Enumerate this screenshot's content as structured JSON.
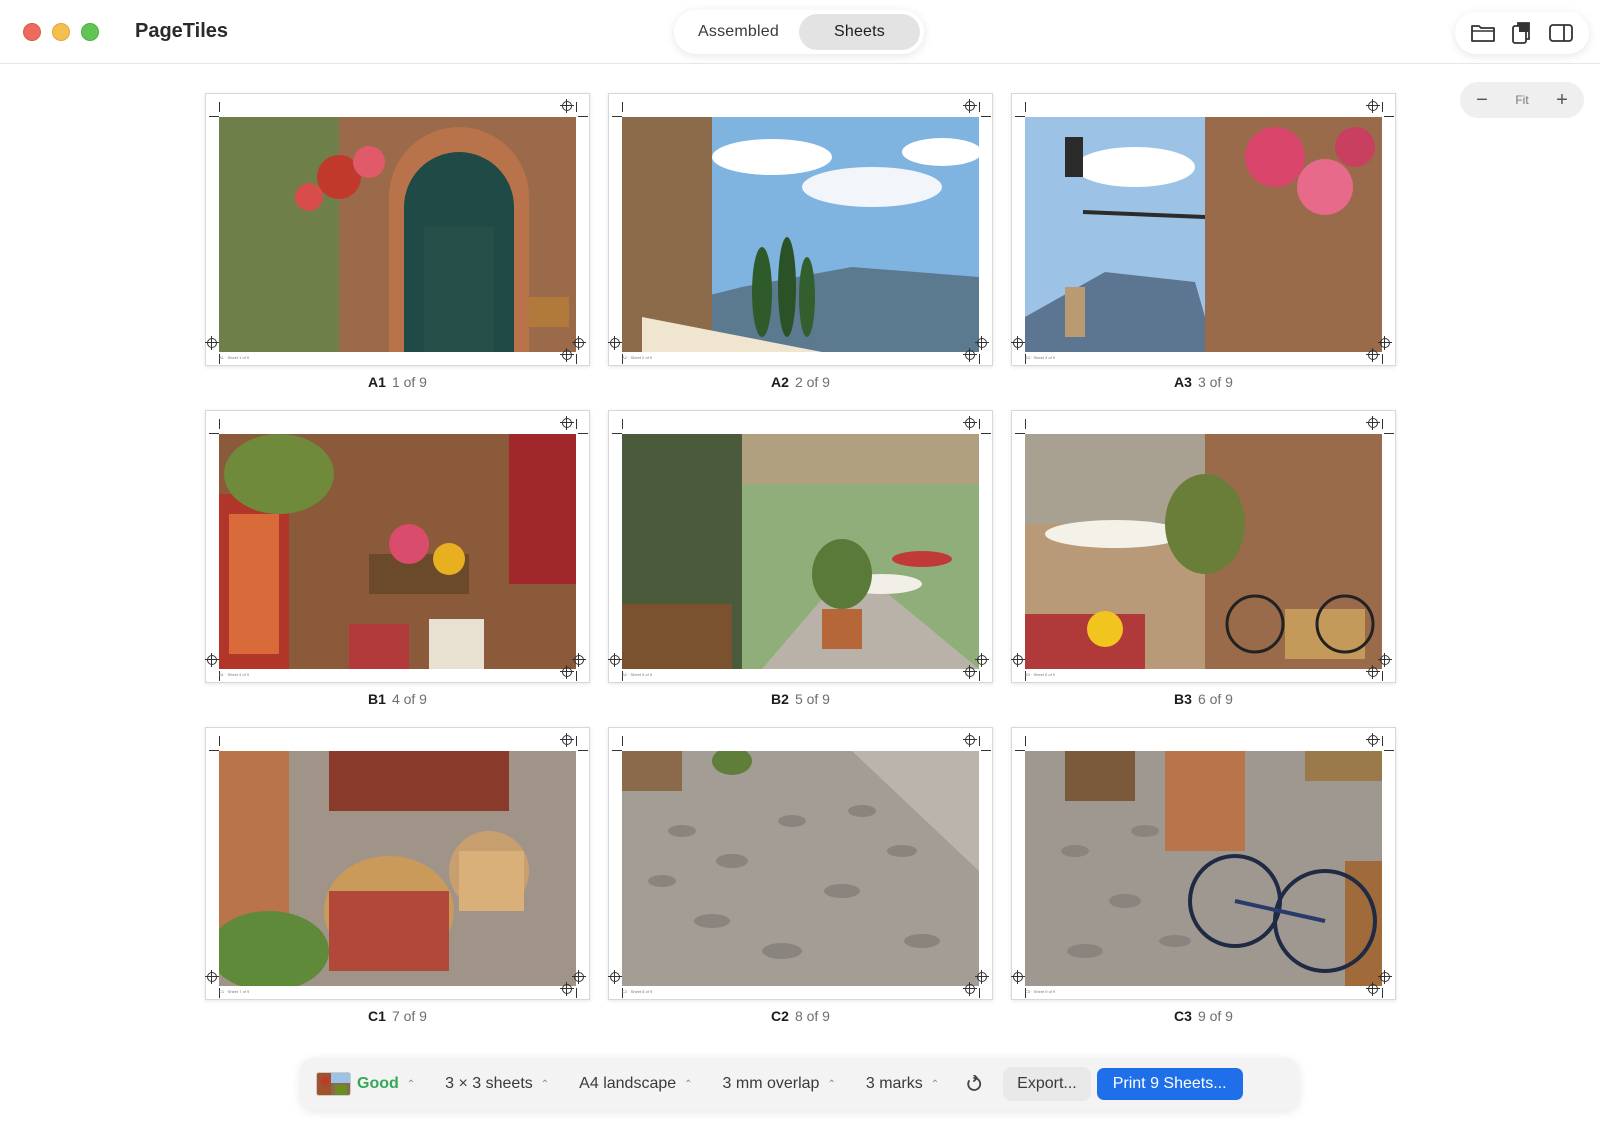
{
  "app": {
    "title": "PageTiles"
  },
  "view_switch": {
    "tabs": [
      {
        "label": "Assembled",
        "active": false
      },
      {
        "label": "Sheets",
        "active": true
      }
    ]
  },
  "toolbar_icons": [
    "folder-icon",
    "copy-pages-icon",
    "sidebar-icon"
  ],
  "zoom": {
    "minus": "−",
    "fit": "Fit",
    "plus": "+"
  },
  "sheets": [
    {
      "id": "A1",
      "position": "1 of 9",
      "footer": "A1 · Sheet 1 of 9"
    },
    {
      "id": "A2",
      "position": "2 of 9",
      "footer": "A2 · Sheet 2 of 9"
    },
    {
      "id": "A3",
      "position": "3 of 9",
      "footer": "A3 · Sheet 3 of 9"
    },
    {
      "id": "B1",
      "position": "4 of 9",
      "footer": "B1 · Sheet 4 of 9"
    },
    {
      "id": "B2",
      "position": "5 of 9",
      "footer": "B2 · Sheet 5 of 9"
    },
    {
      "id": "B3",
      "position": "6 of 9",
      "footer": "B3 · Sheet 6 of 9"
    },
    {
      "id": "C1",
      "position": "7 of 9",
      "footer": "C1 · Sheet 7 of 9"
    },
    {
      "id": "C2",
      "position": "8 of 9",
      "footer": "C2 · Sheet 8 of 9"
    },
    {
      "id": "C3",
      "position": "9 of 9",
      "footer": "C3 · Sheet 9 of 9"
    }
  ],
  "bottom_bar": {
    "quality": "Good",
    "grid": "3 × 3 sheets",
    "paper": "A4 landscape",
    "overlap": "3 mm overlap",
    "marks": "3 marks",
    "export": "Export...",
    "print": "Print 9 Sheets..."
  },
  "colors": {
    "accent": "#1f6feb",
    "good": "#34a853"
  }
}
